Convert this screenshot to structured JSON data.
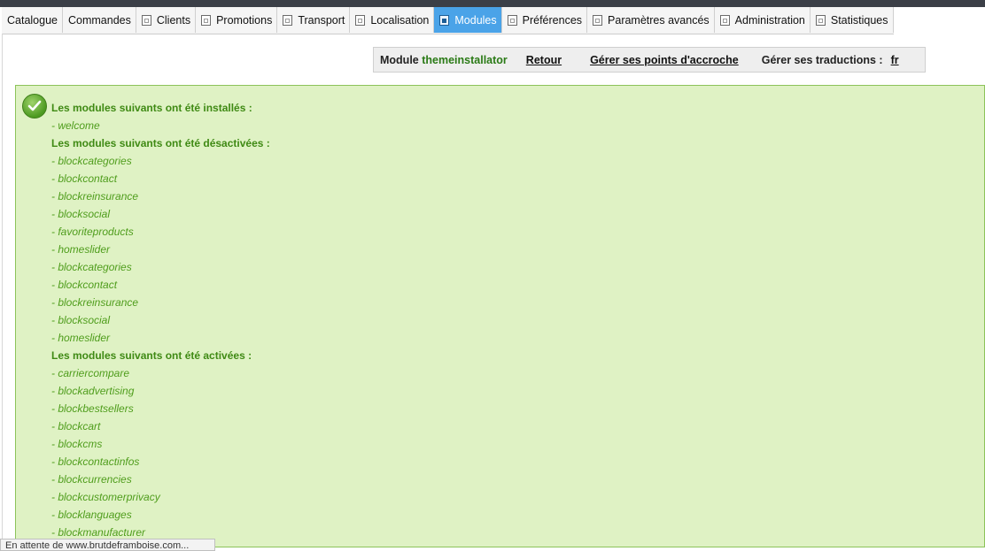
{
  "tabs": [
    {
      "label": "Catalogue",
      "icon": false,
      "active": false
    },
    {
      "label": "Commandes",
      "icon": false,
      "active": false
    },
    {
      "label": "Clients",
      "icon": true,
      "active": false
    },
    {
      "label": "Promotions",
      "icon": true,
      "active": false
    },
    {
      "label": "Transport",
      "icon": true,
      "active": false
    },
    {
      "label": "Localisation",
      "icon": true,
      "active": false
    },
    {
      "label": "Modules",
      "icon": true,
      "active": true
    },
    {
      "label": "Préférences",
      "icon": true,
      "active": false
    },
    {
      "label": "Paramètres avancés",
      "icon": true,
      "active": false
    },
    {
      "label": "Administration",
      "icon": true,
      "active": false
    },
    {
      "label": "Statistiques",
      "icon": true,
      "active": false
    }
  ],
  "toolbar": {
    "module_prefix": "Module",
    "module_name": "themeinstallator",
    "back_label": "Retour",
    "hooks_label": "Gérer ses points d'accroche",
    "translations_label": "Gérer ses traductions :",
    "language_code": "fr"
  },
  "messages": [
    {
      "type": "head",
      "text": "Les modules suivants ont été installés :"
    },
    {
      "type": "item",
      "text": "- welcome"
    },
    {
      "type": "head",
      "text": "Les modules suivants ont été désactivées :"
    },
    {
      "type": "item",
      "text": "- blockcategories"
    },
    {
      "type": "item",
      "text": "- blockcontact"
    },
    {
      "type": "item",
      "text": "- blockreinsurance"
    },
    {
      "type": "item",
      "text": "- blocksocial"
    },
    {
      "type": "item",
      "text": "- favoriteproducts"
    },
    {
      "type": "item",
      "text": "- homeslider"
    },
    {
      "type": "item",
      "text": "- blockcategories"
    },
    {
      "type": "item",
      "text": "- blockcontact"
    },
    {
      "type": "item",
      "text": "- blockreinsurance"
    },
    {
      "type": "item",
      "text": "- blocksocial"
    },
    {
      "type": "item",
      "text": "- homeslider"
    },
    {
      "type": "head",
      "text": "Les modules suivants ont été activées :"
    },
    {
      "type": "item",
      "text": "- carriercompare"
    },
    {
      "type": "item",
      "text": "- blockadvertising"
    },
    {
      "type": "item",
      "text": "- blockbestsellers"
    },
    {
      "type": "item",
      "text": "- blockcart"
    },
    {
      "type": "item",
      "text": "- blockcms"
    },
    {
      "type": "item",
      "text": "- blockcontactinfos"
    },
    {
      "type": "item",
      "text": "- blockcurrencies"
    },
    {
      "type": "item",
      "text": "- blockcustomerprivacy"
    },
    {
      "type": "item",
      "text": "- blocklanguages"
    },
    {
      "type": "item",
      "text": "- blockmanufacturer"
    }
  ],
  "status_bar": "En attente de www.brutdeframboise.com...",
  "colors": {
    "accent": "#4aa3e8",
    "success_bg": "#dff2c4",
    "success_text": "#4f9d1c",
    "module_name": "#2a7a16"
  }
}
